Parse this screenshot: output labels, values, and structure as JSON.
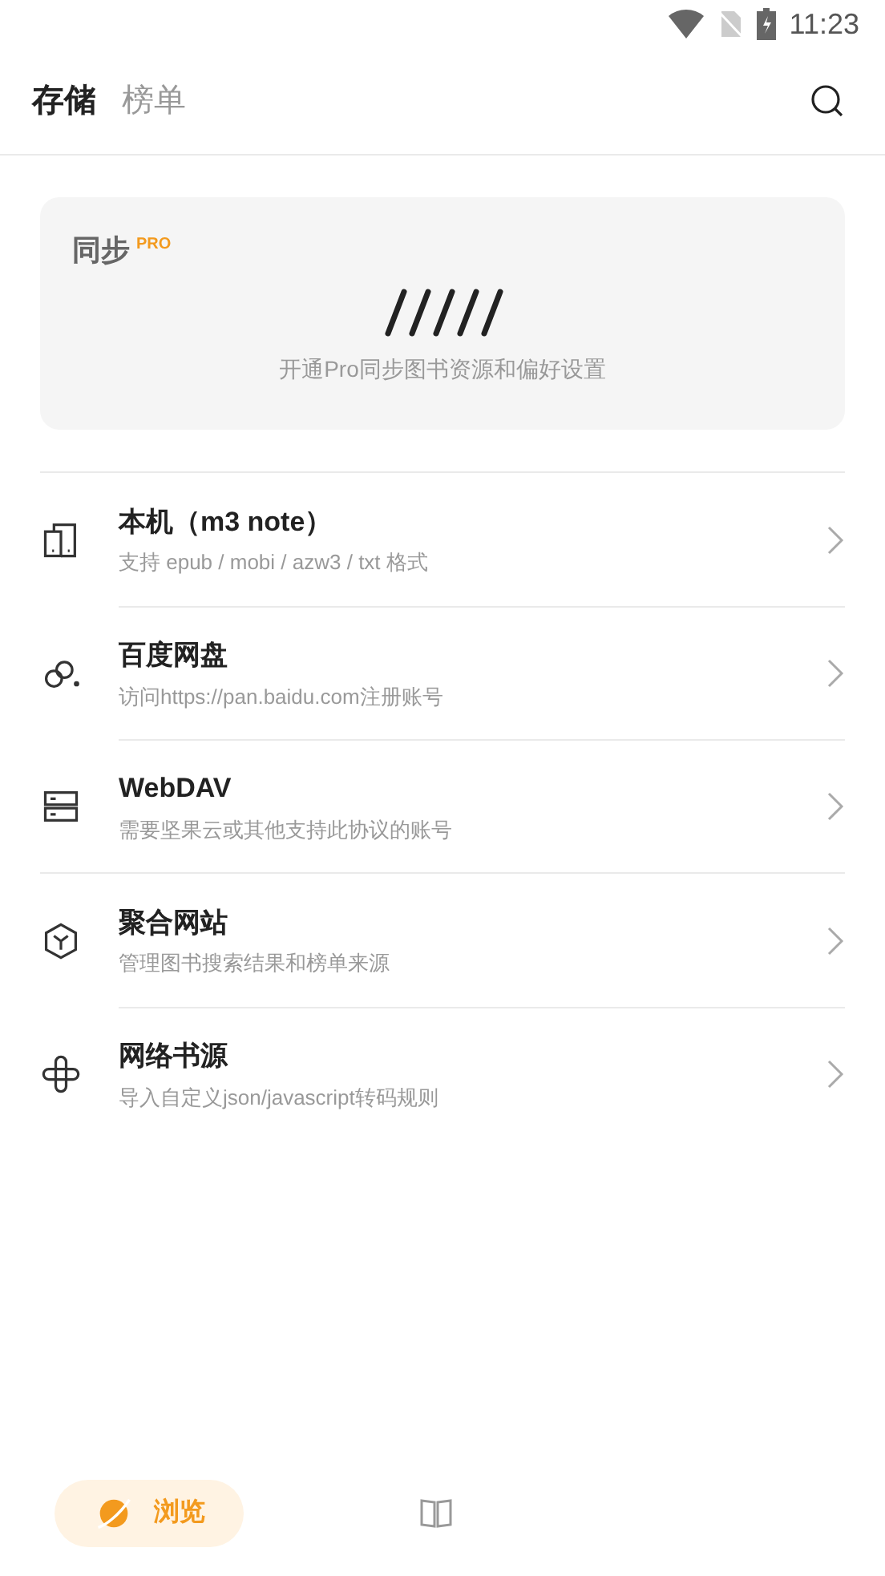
{
  "status_bar": {
    "time": "11:23"
  },
  "tabs": [
    {
      "label": "存储",
      "selected": true
    },
    {
      "label": "榜单",
      "selected": false
    }
  ],
  "sync_card": {
    "title": "同步",
    "badge": "PRO",
    "subtitle": "开通Pro同步图书资源和偏好设置"
  },
  "sections": [
    {
      "items": [
        {
          "kind": "device",
          "title": "本机（m3 note）",
          "subtitle": "支持 epub / mobi / azw3 / txt 格式"
        },
        {
          "kind": "cloud",
          "title": "百度网盘",
          "subtitle": "访问https://pan.baidu.com注册账号"
        },
        {
          "kind": "server",
          "title": "WebDAV",
          "subtitle": "需要坚果云或其他支持此协议的账号"
        }
      ]
    },
    {
      "items": [
        {
          "kind": "cube",
          "title": "聚合网站",
          "subtitle": "管理图书搜索结果和榜单来源"
        },
        {
          "kind": "knot",
          "title": "网络书源",
          "subtitle": "导入自定义json/javascript转码规则"
        }
      ]
    }
  ],
  "bottom_nav": [
    {
      "kind": "planet",
      "label": "浏览",
      "selected": true
    },
    {
      "kind": "book",
      "selected": false
    }
  ]
}
